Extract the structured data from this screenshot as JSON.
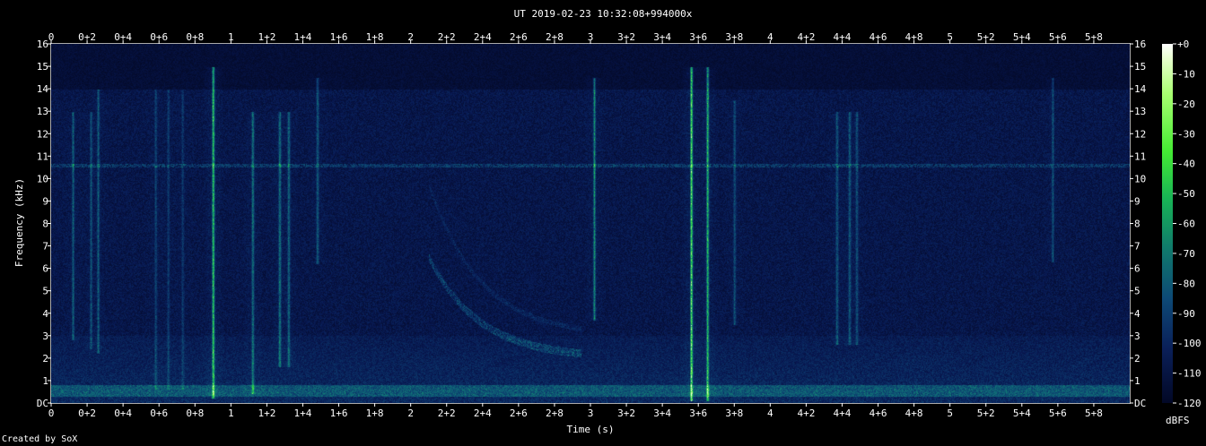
{
  "chart_data": {
    "type": "heatmap",
    "title": "UT 2019-02-23 10:32:08+994000x",
    "xlabel": "Time (s)",
    "ylabel": "Frequency (kHz)",
    "xlim": [
      0,
      6
    ],
    "ylim": [
      0,
      16
    ],
    "x_ticks": [
      "0",
      "0+2",
      "0+4",
      "0+6",
      "0+8",
      "1",
      "1+2",
      "1+4",
      "1+6",
      "1+8",
      "2",
      "2+2",
      "2+4",
      "2+6",
      "2+8",
      "3",
      "3+2",
      "3+4",
      "3+6",
      "3+8",
      "4",
      "4+2",
      "4+4",
      "4+6",
      "4+8",
      "5",
      "5+2",
      "5+4",
      "5+6",
      "5+8"
    ],
    "y_ticks": [
      "DC",
      "1",
      "2",
      "3",
      "4",
      "5",
      "6",
      "7",
      "8",
      "9",
      "10",
      "11",
      "12",
      "13",
      "14",
      "15",
      "16"
    ],
    "colorbar": {
      "label": "dBFS",
      "ticks": [
        "+0",
        "-10",
        "-20",
        "-30",
        "-40",
        "-50",
        "-60",
        "-70",
        "-80",
        "-90",
        "-100",
        "-110",
        "-120"
      ],
      "range": [
        -120,
        0
      ]
    },
    "features": {
      "background_dbfs": -105,
      "low_band_kHz": [
        0.3,
        0.8
      ],
      "tone_line_kHz": 10.6,
      "transients": [
        {
          "t": 0.12,
          "fmin": 2.8,
          "fmax": 13,
          "level": 0.35
        },
        {
          "t": 0.22,
          "fmin": 2.4,
          "fmax": 13,
          "level": 0.3
        },
        {
          "t": 0.26,
          "fmin": 2.2,
          "fmax": 14,
          "level": 0.35
        },
        {
          "t": 0.58,
          "fmin": 0.6,
          "fmax": 14,
          "level": 0.25
        },
        {
          "t": 0.65,
          "fmin": 0.6,
          "fmax": 14,
          "level": 0.22
        },
        {
          "t": 0.73,
          "fmin": 0.6,
          "fmax": 14,
          "level": 0.2
        },
        {
          "t": 0.9,
          "fmin": 0.2,
          "fmax": 15,
          "level": 0.75
        },
        {
          "t": 1.12,
          "fmin": 0.4,
          "fmax": 13,
          "level": 0.45
        },
        {
          "t": 1.27,
          "fmin": 1.6,
          "fmax": 13,
          "level": 0.45
        },
        {
          "t": 1.32,
          "fmin": 1.6,
          "fmax": 13,
          "level": 0.4
        },
        {
          "t": 1.48,
          "fmin": 6.2,
          "fmax": 14.5,
          "level": 0.35
        },
        {
          "t": 3.02,
          "fmin": 3.7,
          "fmax": 14.5,
          "level": 0.5
        },
        {
          "t": 3.56,
          "fmin": 0.1,
          "fmax": 15,
          "level": 0.85
        },
        {
          "t": 3.65,
          "fmin": 0.1,
          "fmax": 15,
          "level": 0.7
        },
        {
          "t": 3.8,
          "fmin": 3.5,
          "fmax": 13.5,
          "level": 0.3
        },
        {
          "t": 4.37,
          "fmin": 2.6,
          "fmax": 13,
          "level": 0.35
        },
        {
          "t": 4.44,
          "fmin": 2.6,
          "fmax": 13,
          "level": 0.35
        },
        {
          "t": 4.48,
          "fmin": 2.6,
          "fmax": 13,
          "level": 0.3
        },
        {
          "t": 5.57,
          "fmin": 6.3,
          "fmax": 14.5,
          "level": 0.3
        }
      ],
      "dispersive_sweep": {
        "t_start": 2.1,
        "t_end": 2.55,
        "f_start": 6.5,
        "f_end": 2.0
      }
    }
  }
}
